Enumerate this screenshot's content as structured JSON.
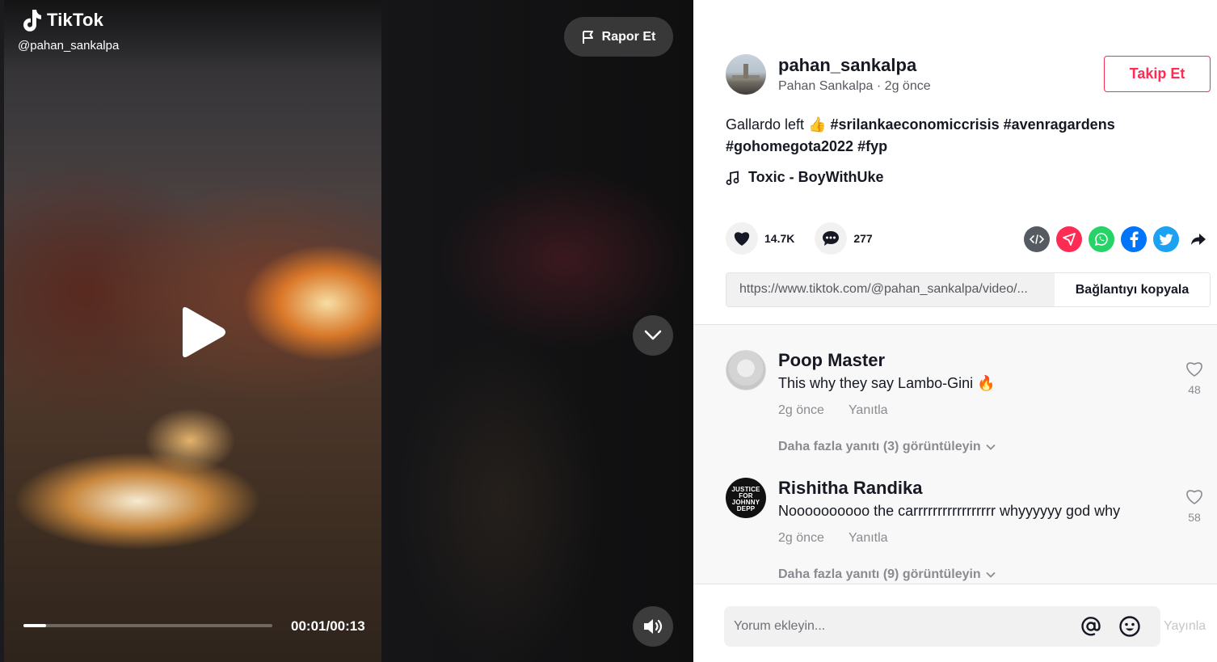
{
  "video": {
    "brand": "TikTok",
    "handle": "@pahan_sankalpa",
    "report_label": "Rapor Et",
    "time": "00:01/00:13",
    "progress_fraction": 0.09
  },
  "author": {
    "username": "pahan_sankalpa",
    "display_name": "Pahan Sankalpa",
    "posted": "2g önce",
    "follow_label": "Takip Et"
  },
  "description": {
    "text": "Gallardo left 👍",
    "hashtags": [
      "#srilankaeconomiccrisis",
      "#avenragardens",
      "#gohomegota2022",
      "#fyp"
    ]
  },
  "music": "Toxic - BoyWithUke",
  "stats": {
    "likes": "14.7K",
    "comments": "277"
  },
  "share": {
    "icons": [
      "embed-icon",
      "send-icon",
      "whatsapp-icon",
      "facebook-icon",
      "twitter-icon",
      "share-arrow-icon"
    ],
    "colors": {
      "embed": "#555b61",
      "send": "#fe2c55",
      "whatsapp": "#25d366",
      "facebook": "#0075fa",
      "twitter": "#1da1f2"
    }
  },
  "link": {
    "url": "https://www.tiktok.com/@pahan_sankalpa/video/...",
    "copy_label": "Bağlantıyı kopyala"
  },
  "comments": [
    {
      "name": "Poop Master",
      "text": "This why they say Lambo-Gini 🔥",
      "time": "2g önce",
      "reply": "Yanıtla",
      "likes": "48",
      "more": "Daha fazla yanıtı (3) görüntüleyin"
    },
    {
      "name": "Rishitha Randika",
      "avatar_text": "JUSTICE FOR JOHNNY DEPP",
      "text": "Noooooooooo the carrrrrrrrrrrrrrrrr whyyyyyy god why",
      "time": "2g önce",
      "reply": "Yanıtla",
      "likes": "58",
      "more": "Daha fazla yanıtı (9) görüntüleyin"
    }
  ],
  "comment_input": {
    "placeholder": "Yorum ekleyin...",
    "post_label": "Yayınla"
  },
  "colors": {
    "accent": "#fe2c55",
    "text": "#161823",
    "muted": "#8a8b91"
  }
}
